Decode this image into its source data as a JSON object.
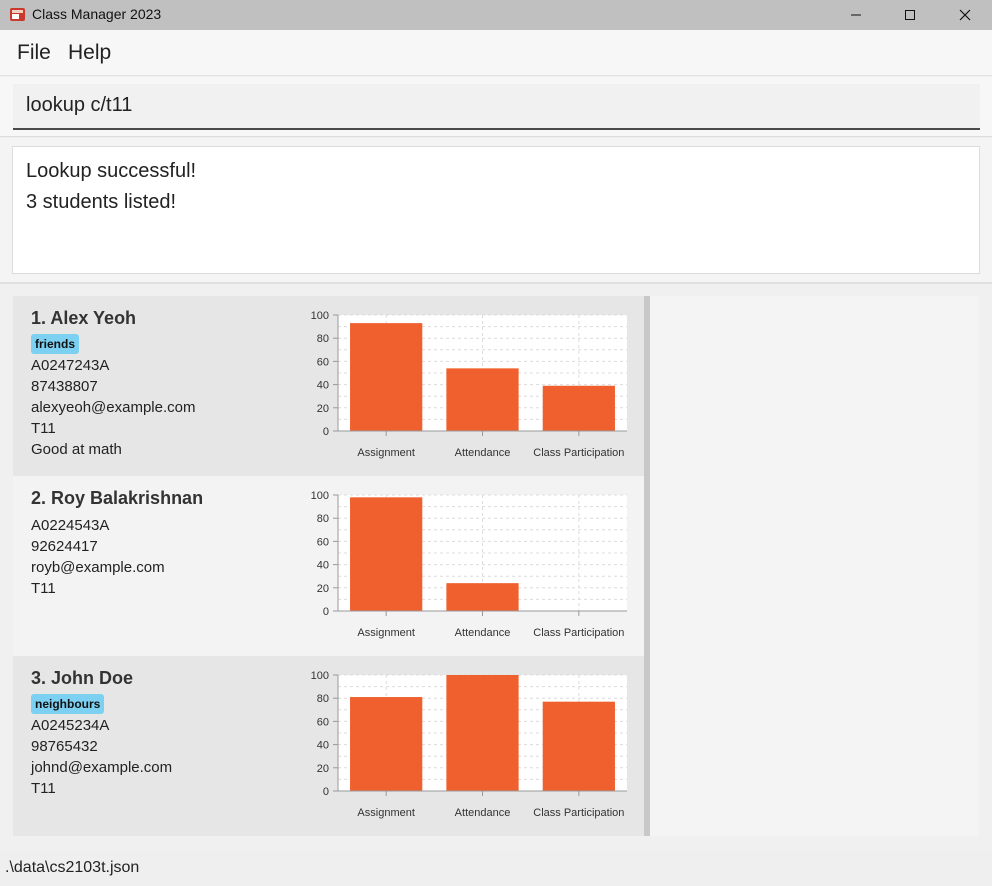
{
  "window": {
    "title": "Class Manager 2023",
    "icon": "app-logo-icon"
  },
  "menu": {
    "items": [
      {
        "label": "File"
      },
      {
        "label": "Help"
      }
    ]
  },
  "command": {
    "value": "lookup c/t11"
  },
  "result": {
    "lines": [
      "Lookup successful!",
      "3 students listed!"
    ]
  },
  "students": [
    {
      "name": "1.  Alex Yeoh",
      "tag": "friends",
      "fields": [
        "A0247243A",
        "87438807",
        "alexyeoh@example.com",
        "T11",
        "Good at math"
      ],
      "chart_data": {
        "type": "bar",
        "categories": [
          "Assignment",
          "Attendance",
          "Class Participation"
        ],
        "values": [
          93,
          54,
          39
        ],
        "ylim": [
          0,
          100
        ],
        "yticks": [
          "0",
          "20",
          "40",
          "60",
          "80",
          "100"
        ]
      }
    },
    {
      "name": "2.  Roy Balakrishnan",
      "tag": "",
      "fields": [
        "A0224543A",
        "92624417",
        "royb@example.com",
        "T11"
      ],
      "chart_data": {
        "type": "bar",
        "categories": [
          "Assignment",
          "Attendance",
          "Class Participation"
        ],
        "values": [
          98,
          24,
          0
        ],
        "ylim": [
          0,
          100
        ],
        "yticks": [
          "0",
          "20",
          "40",
          "60",
          "80",
          "100"
        ]
      }
    },
    {
      "name": "3.  John Doe",
      "tag": "neighbours",
      "fields": [
        "A0245234A",
        "98765432",
        "johnd@example.com",
        "T11"
      ],
      "chart_data": {
        "type": "bar",
        "categories": [
          "Assignment",
          "Attendance",
          "Class Participation"
        ],
        "values": [
          81,
          100,
          77
        ],
        "ylim": [
          0,
          100
        ],
        "yticks": [
          "0",
          "20",
          "40",
          "60",
          "80",
          "100"
        ]
      }
    }
  ],
  "status": {
    "path": ".\\data\\cs2103t.json"
  },
  "colors": {
    "bar": "#f0602e",
    "tag": "#7cd0f2"
  }
}
